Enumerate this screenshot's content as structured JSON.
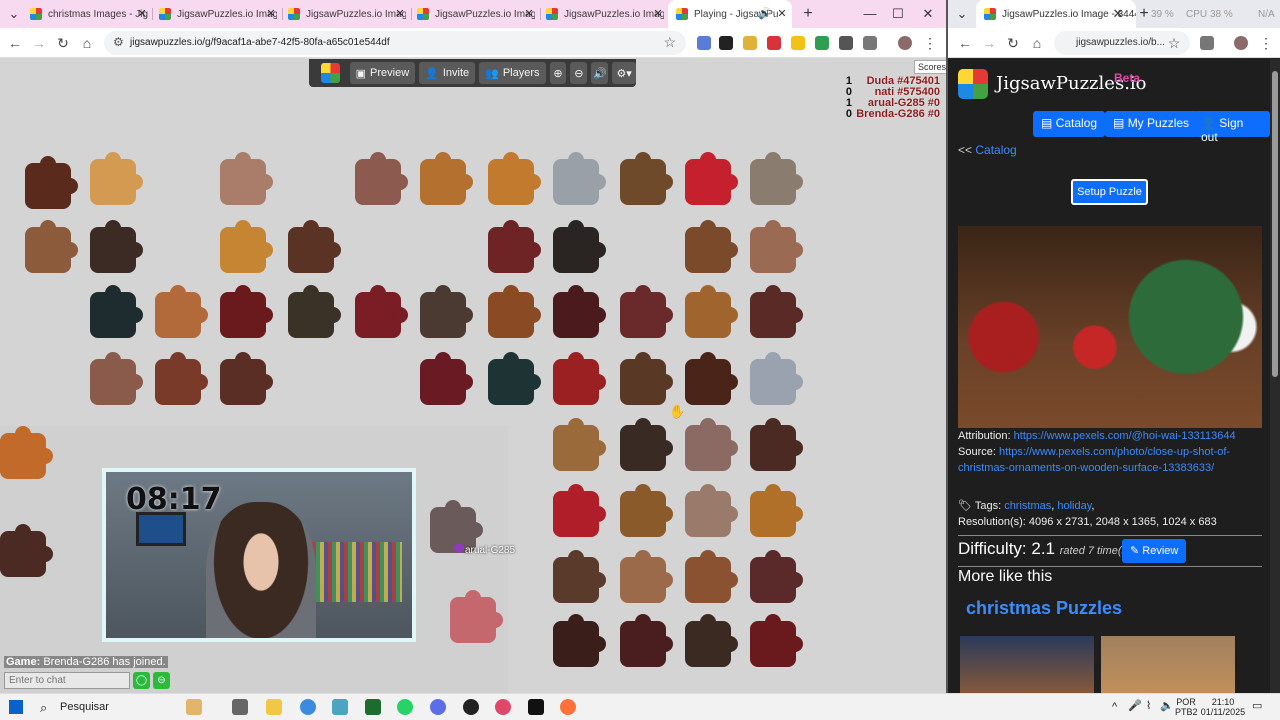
{
  "left_window": {
    "tabs": [
      {
        "label": "christmas Images - Jig",
        "active": false
      },
      {
        "label": "JigsawPuzzles.io Image",
        "active": false
      },
      {
        "label": "JigsawPuzzles.io Image",
        "active": false
      },
      {
        "label": "JigsawPuzzles.io Image",
        "active": false
      },
      {
        "label": "JigsawPuzzles.io Image",
        "active": false
      },
      {
        "label": "Playing - JigsawPu",
        "active": true
      }
    ],
    "new_tab": "+",
    "url": "jigsawpuzzles.io/g/f9acaf1a-abe7-42f5-80fa-a65c01e544df",
    "window_controls": {
      "minimize": "—",
      "maximize": "☐",
      "close": "✕"
    }
  },
  "game": {
    "menu": {
      "preview": "Preview",
      "invite": "Invite",
      "players": "Players"
    },
    "scores_tooltip": "Scores",
    "scores": [
      {
        "count": "1",
        "name": "Duda #475401"
      },
      {
        "count": "0",
        "name": "nati #575400"
      },
      {
        "count": "1",
        "name": "arual-G285 #0"
      },
      {
        "count": "0",
        "name": "Brenda-G286 #0"
      }
    ],
    "webcam_timer": "08:17",
    "cursor_label": "arual-G285",
    "chat": {
      "system_prefix": "Game:",
      "message": "Brenda-G286 has joined.",
      "input_placeholder": "Enter to chat"
    }
  },
  "right_window": {
    "tab_label": "JigsawPuzzles.io Image - 3444",
    "sysmon": {
      "ram": "39 %",
      "cpu_label": "CPU",
      "cpu": "38 %",
      "gpu": "N/A"
    },
    "url": "jigsawpuzzles.io/b...",
    "site": {
      "title": "JigsawPuzzles.io",
      "beta": "Beta",
      "nav": {
        "catalog": "Catalog",
        "my_puzzles": "My Puzzles",
        "sign_out": "Sign out"
      },
      "breadcrumb_prefix": "<<",
      "breadcrumb_link": "Catalog",
      "setup_button": "Setup Puzzle",
      "attribution_label": "Attribution:",
      "attribution_url": "https://www.pexels.com/@hoi-wai-133113644",
      "source_label": "Source:",
      "source_url": "https://www.pexels.com/photo/close-up-shot-of-christmas-ornaments-on-wooden-surface-13383633/",
      "tags_label": "Tags:",
      "tag1": "christmas",
      "tag2": "holiday",
      "tags_trailing": ",",
      "resolutions": "Resolution(s): 4096 x 2731, 2048 x 1365, 1024 x 683",
      "difficulty_label": "Difficulty: 2.1",
      "difficulty_rated": "rated 7 time(s)",
      "review_button": "Review",
      "more_like_this": "More like this",
      "category_title": "christmas Puzzles"
    }
  },
  "taskbar": {
    "search_placeholder": "Pesquisar",
    "lang_top": "POR",
    "lang_bottom": "PTB2",
    "time": "21:10",
    "date": "01/11/2025"
  }
}
